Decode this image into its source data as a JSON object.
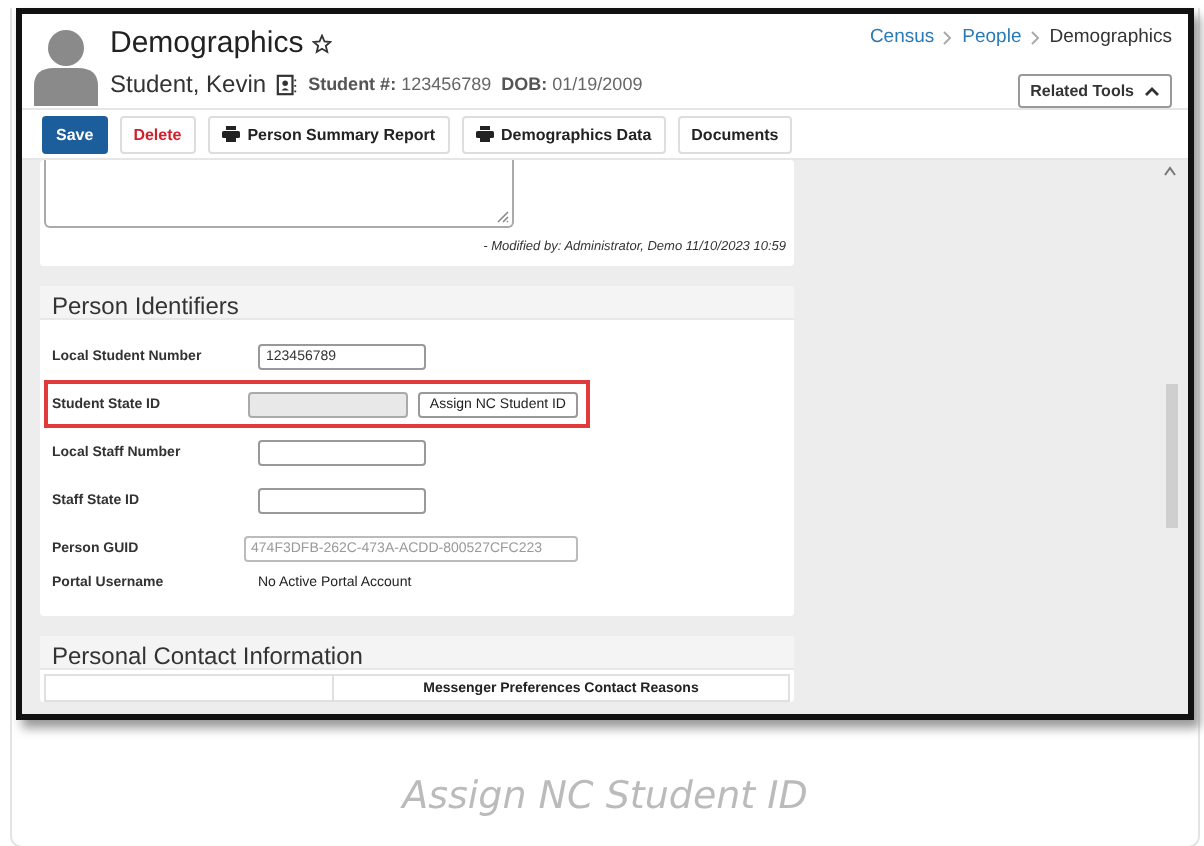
{
  "header": {
    "title": "Demographics",
    "name": "Student, Kevin",
    "student_number_label": "Student #:",
    "student_number": "123456789",
    "dob_label": "DOB:",
    "dob": "01/19/2009"
  },
  "breadcrumb": [
    {
      "label": "Census",
      "link": true
    },
    {
      "label": "People",
      "link": true
    },
    {
      "label": "Demographics",
      "link": false
    }
  ],
  "related_tools": "Related Tools",
  "toolbar": [
    {
      "label": "Save",
      "kind": "primary"
    },
    {
      "label": "Delete",
      "kind": "danger"
    },
    {
      "label": "Person Summary Report",
      "kind": "print"
    },
    {
      "label": "Demographics Data",
      "kind": "print"
    },
    {
      "label": "Documents",
      "kind": "plain"
    }
  ],
  "comments_card": {
    "modified": "- Modified by: Administrator, Demo 11/10/2023 10:59"
  },
  "identifiers": {
    "title": "Person Identifiers",
    "fields": [
      {
        "label": "Local Student Number",
        "kind": "input",
        "value": "123456789",
        "highlighted": false
      },
      {
        "label": "Student State ID",
        "kind": "assign",
        "disabled": true,
        "button": "Assign NC Student ID",
        "highlighted": true
      },
      {
        "label": "Local Staff Number",
        "kind": "input",
        "highlighted": false
      },
      {
        "label": "Staff State ID",
        "kind": "input",
        "highlighted": false
      },
      {
        "label": "Person GUID",
        "kind": "wide",
        "value": "474F3DFB-262C-473A-ACDD-800527CFC223",
        "disabled": true,
        "highlighted": false
      },
      {
        "label": "Portal Username",
        "kind": "text",
        "value": "No Active Portal Account",
        "highlighted": false
      }
    ]
  },
  "contact": {
    "title": "Personal Contact Information",
    "column_2": "Messenger Preferences Contact Reasons"
  },
  "caption": "Assign NC Student ID"
}
